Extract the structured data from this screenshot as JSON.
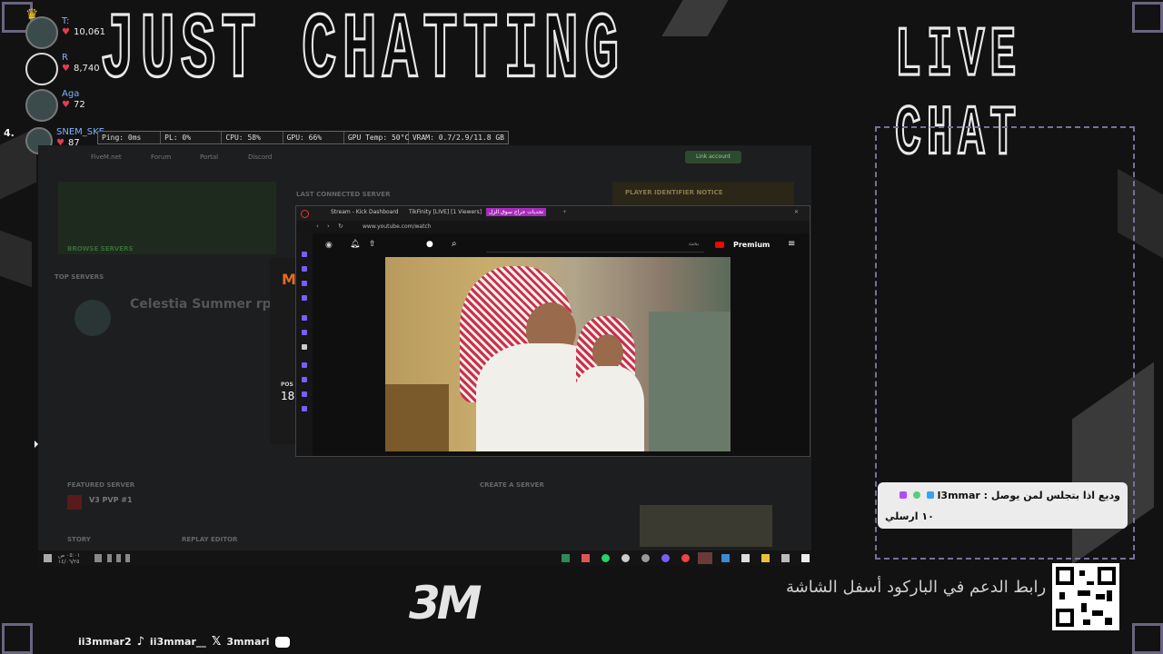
{
  "overlay": {
    "category_title": "JUST CHATTING",
    "chat_title": "LIVE CHAT",
    "support_text": "رابط الدعم في الباركود أسفل الشاشة",
    "logo_text": "3M"
  },
  "leaderboard": [
    {
      "name": "T:",
      "score": "10,061"
    },
    {
      "name": "R",
      "score": "8,740"
    },
    {
      "name": "Aga",
      "score": "72"
    },
    {
      "rank": "4.",
      "name": "SNEM_SKE",
      "score": "87"
    }
  ],
  "stats": {
    "ping": "Ping: 0ms",
    "pl": "PL: 0%",
    "cpu": "CPU: 58%",
    "gpu": "GPU: 66%",
    "gpu_temp": "GPU Temp: 50°C",
    "vram": "VRAM: 0.7/2.9/11.8 GB"
  },
  "fivem": {
    "links": [
      "FiveM.net",
      "Forum",
      "Portal",
      "Discord"
    ],
    "last_connected": "LAST CONNECTED SERVER",
    "player_identifier": "PLAYER IDENTIFIER NOTICE",
    "browse_servers": "BROWSE SERVERS",
    "top_servers": "TOP SERVERS",
    "server_name": "Celestia Summer rp new",
    "featured_server": "FEATURED SERVER",
    "featured_name": "V3 PVP #1",
    "create_server": "CREATE A SERVER",
    "story": "STORY",
    "replay_editor": "REPLAY EDITOR",
    "link_account": "Link account",
    "pos_label": "POS",
    "pos_value": "18"
  },
  "taskbar": {
    "time": "٠٥:٠١ ص",
    "date": "١٤/٠٦/٢٥"
  },
  "browser": {
    "tabs": [
      {
        "label": "Stream - Kick Dashboard",
        "active": false
      },
      {
        "label": "TikFinity [LIVE] [1 Viewers]",
        "active": false
      },
      {
        "label": "تحديات جراج سوق الزل",
        "active": true
      }
    ],
    "url": "www.youtube.com/watch",
    "search_placeholder": "بحث",
    "premium_label": "Premium"
  },
  "chat": {
    "message_line1": "وديع اذا بتجلس لمن يوصل : l3mmar",
    "message_line2": "١٠ ارسلي",
    "badge_colors": [
      "#b04bf5",
      "#55d07a",
      "#3aa0f5"
    ]
  },
  "socials": {
    "kick": "ii3mmar2",
    "tiktok": "ii3mmar__",
    "x": "3mmari",
    "icons": [
      "tiktok-icon",
      "x-icon",
      "discord-icon"
    ]
  },
  "colors": {
    "panel_border": "#7b6f9a",
    "accent_purple": "#a82bbd",
    "heart": "#e43c4e"
  }
}
